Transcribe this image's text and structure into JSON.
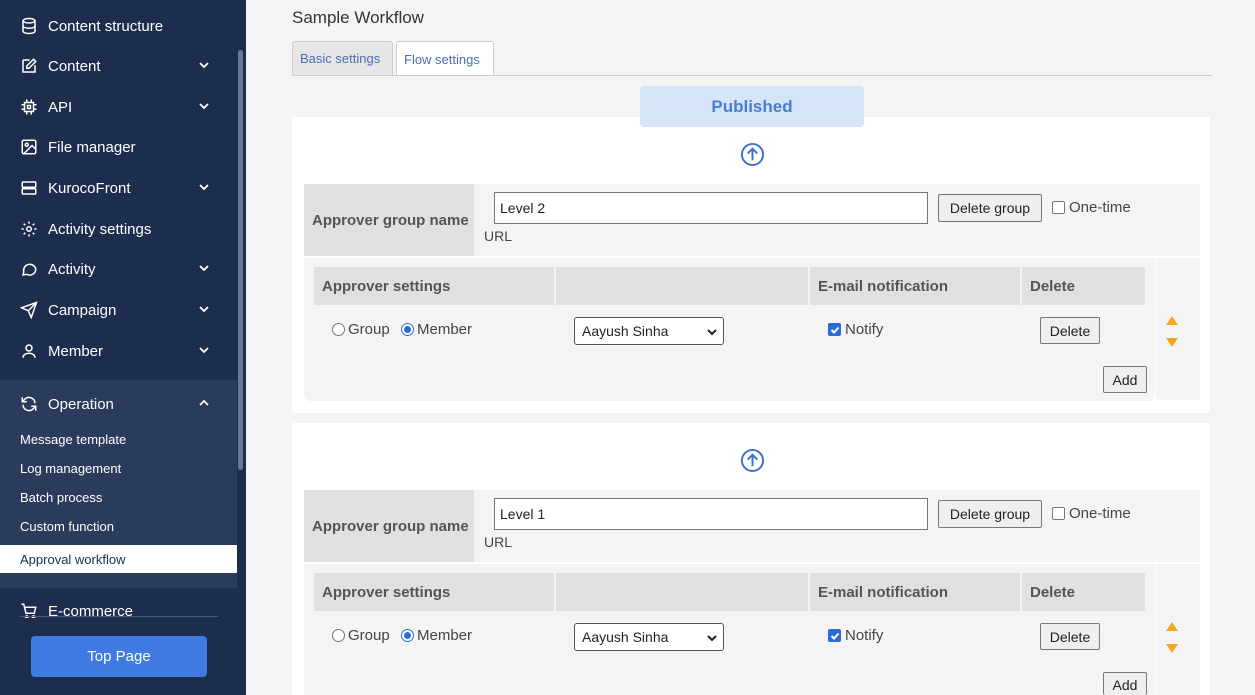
{
  "sidebar": {
    "items": [
      {
        "label": "Content structure",
        "icon": "database-icon"
      },
      {
        "label": "Content",
        "icon": "edit-icon"
      },
      {
        "label": "API",
        "icon": "chip-icon"
      },
      {
        "label": "File manager",
        "icon": "image-icon"
      },
      {
        "label": "KurocoFront",
        "icon": "server-icon"
      },
      {
        "label": "Activity settings",
        "icon": "gear-icon"
      },
      {
        "label": "Activity",
        "icon": "chat-icon"
      },
      {
        "label": "Campaign",
        "icon": "send-icon"
      },
      {
        "label": "Member",
        "icon": "user-icon"
      },
      {
        "label": "Operation",
        "icon": "refresh-icon"
      },
      {
        "label": "E-commerce",
        "icon": "cart-icon"
      }
    ],
    "operation_sub": [
      {
        "label": "Message template"
      },
      {
        "label": "Log management"
      },
      {
        "label": "Batch process"
      },
      {
        "label": "Custom function"
      },
      {
        "label": "Approval workflow"
      }
    ],
    "top_page_label": "Top Page"
  },
  "main": {
    "title": "Sample Workflow",
    "tabs": [
      {
        "label": "Basic settings"
      },
      {
        "label": "Flow settings"
      }
    ],
    "status": "Published",
    "groups": [
      {
        "label": "Approver group name",
        "name_value": "Level 2",
        "url_label": "URL",
        "delete_group_label": "Delete group",
        "one_time_label": "One-time",
        "settings_headers": [
          "Approver settings",
          "",
          "E-mail notification",
          "Delete"
        ],
        "group_label": "Group",
        "member_label": "Member",
        "selected_member": "Aayush Sinha",
        "notify_label": "Notify",
        "delete_label": "Delete",
        "add_label": "Add"
      },
      {
        "label": "Approver group name",
        "name_value": "Level 1",
        "url_label": "URL",
        "delete_group_label": "Delete group",
        "one_time_label": "One-time",
        "settings_headers": [
          "Approver settings",
          "",
          "E-mail notification",
          "Delete"
        ],
        "group_label": "Group",
        "member_label": "Member",
        "selected_member": "Aayush Sinha",
        "notify_label": "Notify",
        "delete_label": "Delete",
        "add_label": "Add"
      }
    ]
  },
  "colors": {
    "sidebar_bg": "#1c2d4e",
    "accent": "#3f7ae0",
    "warning_arrow": "#f3a820",
    "published_bg": "#d6e4f8"
  }
}
